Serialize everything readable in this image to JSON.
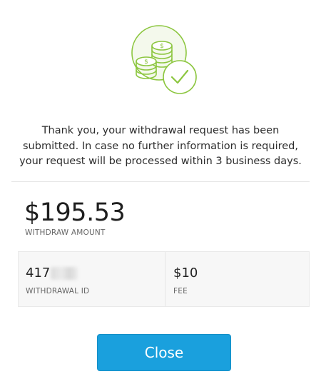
{
  "hero": {
    "icon_name": "coins-check-icon",
    "accent": "#8cc63f"
  },
  "message": {
    "lines": [
      "Thank you, your withdrawal request has been",
      "submitted. In case no further information is required,",
      "your request will be processed within 3 business days."
    ]
  },
  "amount": {
    "value": "$195.53",
    "label": "WITHDRAW AMOUNT"
  },
  "details": {
    "withdrawal_id": {
      "value_visible": "417",
      "label": "WITHDRAWAL ID"
    },
    "fee": {
      "value": "$10",
      "label": "FEE"
    }
  },
  "close_button": {
    "label": "Close",
    "color": "#1aa0dd"
  }
}
